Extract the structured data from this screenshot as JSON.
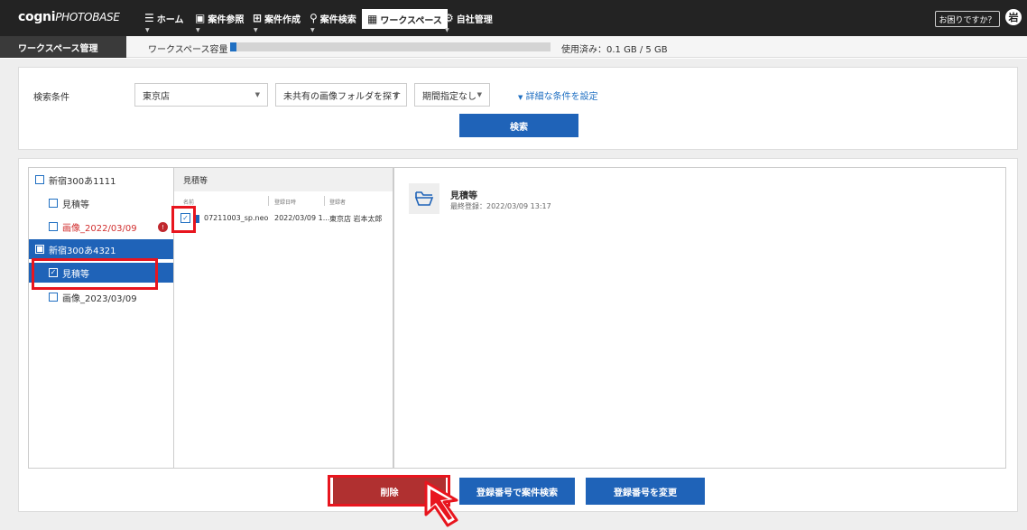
{
  "header": {
    "logo_bold": "cogni",
    "logo_light": "PHOTOBASE",
    "nav": [
      {
        "label": "ホーム",
        "icon": "list-icon"
      },
      {
        "label": "案件参照",
        "icon": "image-icon"
      },
      {
        "label": "案件作成",
        "icon": "add-image-icon"
      },
      {
        "label": "案件検索",
        "icon": "search-icon"
      },
      {
        "label": "ワークスペース",
        "icon": "workspace-icon"
      },
      {
        "label": "自社管理",
        "icon": "gear-icon"
      }
    ],
    "help_label": "お困りですか？",
    "avatar_label": "岩"
  },
  "subbar": {
    "title": "ワークスペース管理",
    "capacity_label": "ワークスペース容量",
    "used_text": "使用済み：0.1 GB / 5 GB",
    "used_fraction": 0.02
  },
  "search": {
    "label": "検索条件",
    "store_select": "東京店",
    "folder_select": "未共有の画像フォルダを探す",
    "period_select": "期間指定なし",
    "advanced_link": "詳細な条件を設定",
    "search_button": "検索"
  },
  "tree": [
    {
      "label": "新宿300あ1111",
      "level": 0,
      "state": "unchecked"
    },
    {
      "label": "見積等",
      "level": 1,
      "state": "unchecked"
    },
    {
      "label": "画像_2022/03/09",
      "level": 1,
      "state": "unchecked",
      "warning": true
    },
    {
      "label": "新宿300あ4321",
      "level": 0,
      "state": "partial",
      "selected": true
    },
    {
      "label": "見積等",
      "level": 1,
      "state": "checked",
      "selected": true
    },
    {
      "label": "画像_2023/03/09",
      "level": 1,
      "state": "unchecked"
    }
  ],
  "files": {
    "folder_title": "見積等",
    "columns": [
      "名前",
      "登録日時",
      "登録者"
    ],
    "rows": [
      {
        "name": "07211003_sp.neo",
        "date": "2022/03/09 1...",
        "user": "東京店 岩本太郎",
        "checked": true
      }
    ]
  },
  "detail": {
    "title": "見積等",
    "meta": "最終登録：2022/03/09 13:17",
    "icon": "folder-open-icon"
  },
  "actions": {
    "delete": "削除",
    "search_by_number": "登録番号で案件検索",
    "change_number": "登録番号を変更"
  },
  "colors": {
    "accent": "#1f63b8",
    "delete": "#b03030",
    "highlight": "#e8151e",
    "warning": "#d12e2e"
  }
}
